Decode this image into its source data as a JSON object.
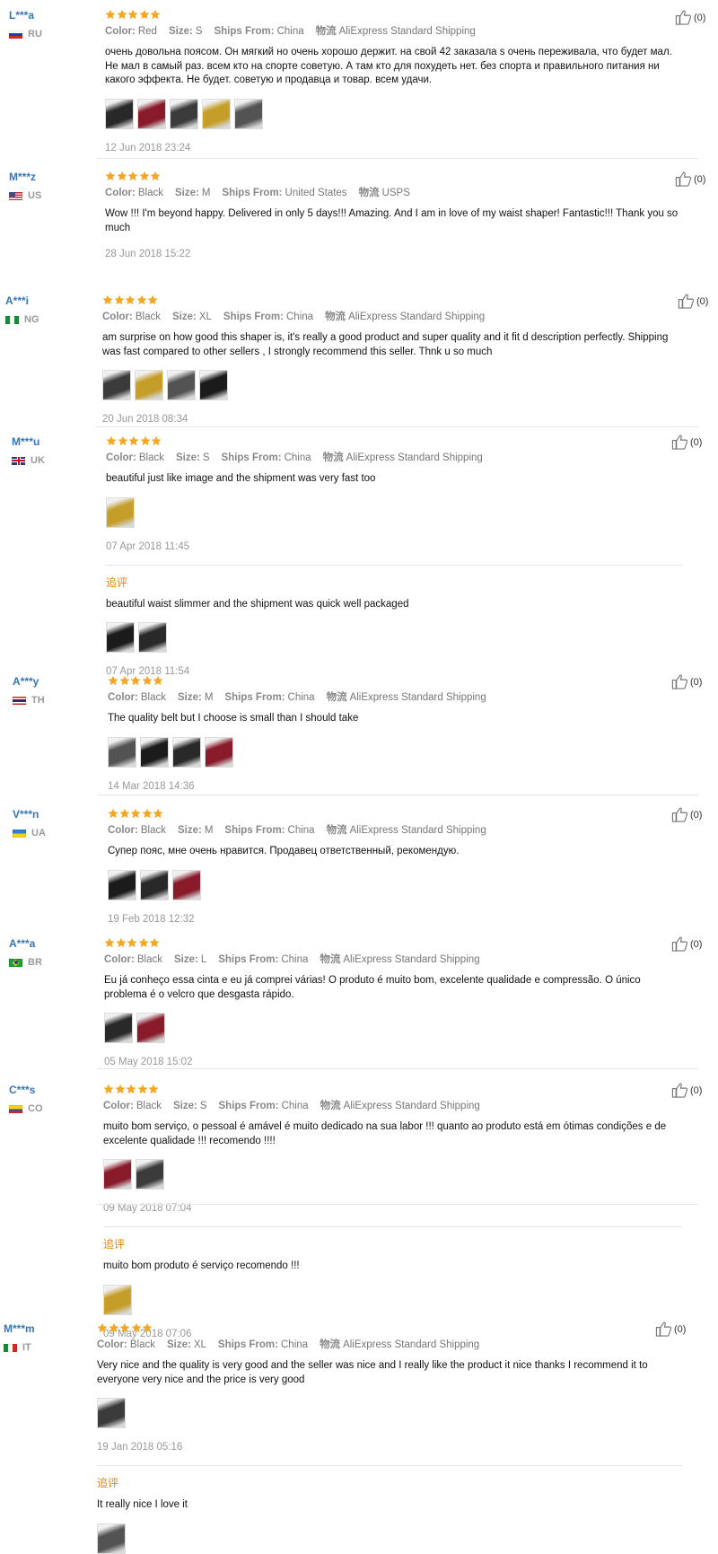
{
  "labels": {
    "color": "Color:",
    "size": "Size:",
    "ships_from": "Ships From:",
    "logistics": "物流",
    "followup": "追评"
  },
  "colors": {
    "star": "#f5a623",
    "username": "#3576b8",
    "followup": "#e8820c"
  },
  "reviews": [
    {
      "user": "L***a",
      "country": "RU",
      "flag": "flag-ru",
      "stars": 5,
      "color": "Red",
      "size": "S",
      "ships_from": "China",
      "logistics": "AliExpress Standard Shipping",
      "text": "очень довольна поясом. Он мягкий но очень хорошо держит. на свой 42 заказала s очень переживала, что будет мал. Не мал в самый раз. всем кто на спорте советую. А там кто для похудеть нет. без спорта и правильного питания ни какого эффекта. Не будет. советую и продавца и товар. всем удачи.",
      "photos": 5,
      "date": "12 Jun 2018 23:24",
      "helpful": "(0)"
    },
    {
      "user": "M***z",
      "country": "US",
      "flag": "flag-us",
      "stars": 5,
      "color": "Black",
      "size": "M",
      "ships_from": "United States",
      "logistics": "USPS",
      "text": "Wow !!! I'm beyond happy. Delivered in only 5 days!!! Amazing. And I am in love of my waist shaper! Fantastic!!! Thank you so much",
      "photos": 0,
      "date": "28 Jun 2018 15:22",
      "helpful": "(0)"
    },
    {
      "user": "A***i",
      "country": "NG",
      "flag": "flag-ng",
      "stars": 5,
      "color": "Black",
      "size": "XL",
      "ships_from": "China",
      "logistics": "AliExpress Standard Shipping",
      "text": "am surprise on how good this shaper is, it's really a good product and super quality and it fit d description perfectly. Shipping was fast compared to other sellers , I strongly recommend this seller. Thnk u so much",
      "photos": 4,
      "date": "20 Jun 2018 08:34",
      "helpful": "(0)"
    },
    {
      "user": "M***u",
      "country": "UK",
      "flag": "flag-uk",
      "stars": 5,
      "color": "Black",
      "size": "S",
      "ships_from": "China",
      "logistics": "AliExpress Standard Shipping",
      "text": "beautiful just like image and the shipment was very fast too",
      "photos": 1,
      "date": "07 Apr 2018 11:45",
      "helpful": "(0)",
      "followup": {
        "text": "beautiful waist slimmer and the shipment was quick well packaged",
        "photos": 2,
        "date": "07 Apr 2018 11:54"
      }
    },
    {
      "user": "A***y",
      "country": "TH",
      "flag": "flag-th",
      "stars": 5,
      "color": "Black",
      "size": "M",
      "ships_from": "China",
      "logistics": "AliExpress Standard Shipping",
      "text": "The quality belt but I choose is small than I should take",
      "photos": 4,
      "date": "14 Mar 2018 14:36",
      "helpful": "(0)"
    },
    {
      "user": "V***n",
      "country": "UA",
      "flag": "flag-ua",
      "stars": 5,
      "color": "Black",
      "size": "M",
      "ships_from": "China",
      "logistics": "AliExpress Standard Shipping",
      "text": "Супер пояс, мне очень нравится. Продавец ответственный, рекомендую.",
      "photos": 3,
      "date": "19 Feb 2018 12:32",
      "helpful": "(0)"
    },
    {
      "user": "A***a",
      "country": "BR",
      "flag": "flag-br",
      "stars": 5,
      "color": "Black",
      "size": "L",
      "ships_from": "China",
      "logistics": "AliExpress Standard Shipping",
      "text": "Eu já conheço essa cinta e eu já comprei várias! O produto é muito bom, excelente qualidade e compressão. O único problema é o velcro que desgasta rápido.",
      "photos": 2,
      "date": "05 May 2018 15:02",
      "helpful": "(0)"
    },
    {
      "user": "C***s",
      "country": "CO",
      "flag": "flag-co",
      "stars": 5,
      "color": "Black",
      "size": "S",
      "ships_from": "China",
      "logistics": "AliExpress Standard Shipping",
      "text": "muito bom serviço, o pessoal é amável é muito dedicado na sua labor !!! quanto ao produto está em ótimas condições e de excelente qualidade !!! recomendo !!!!",
      "photos": 2,
      "date": "09 May 2018 07:04",
      "helpful": "(0)",
      "followup": {
        "text": "muito bom produto é serviço recomendo !!!",
        "photos": 1,
        "date": "09 May 2018 07:06"
      }
    },
    {
      "user": "M***m",
      "country": "IT",
      "flag": "flag-it",
      "stars": 5,
      "color": "Black",
      "size": "XL",
      "ships_from": "China",
      "logistics": "AliExpress Standard Shipping",
      "text": "Very nice and the quality is very good and the seller was nice and I really like the product it nice thanks I recommend it to everyone very nice and the price is very good",
      "photos": 1,
      "date": "19 Jan 2018 05:16",
      "helpful": "(0)",
      "followup": {
        "text": "It really nice I love it",
        "photos": 1,
        "date": ""
      }
    }
  ]
}
